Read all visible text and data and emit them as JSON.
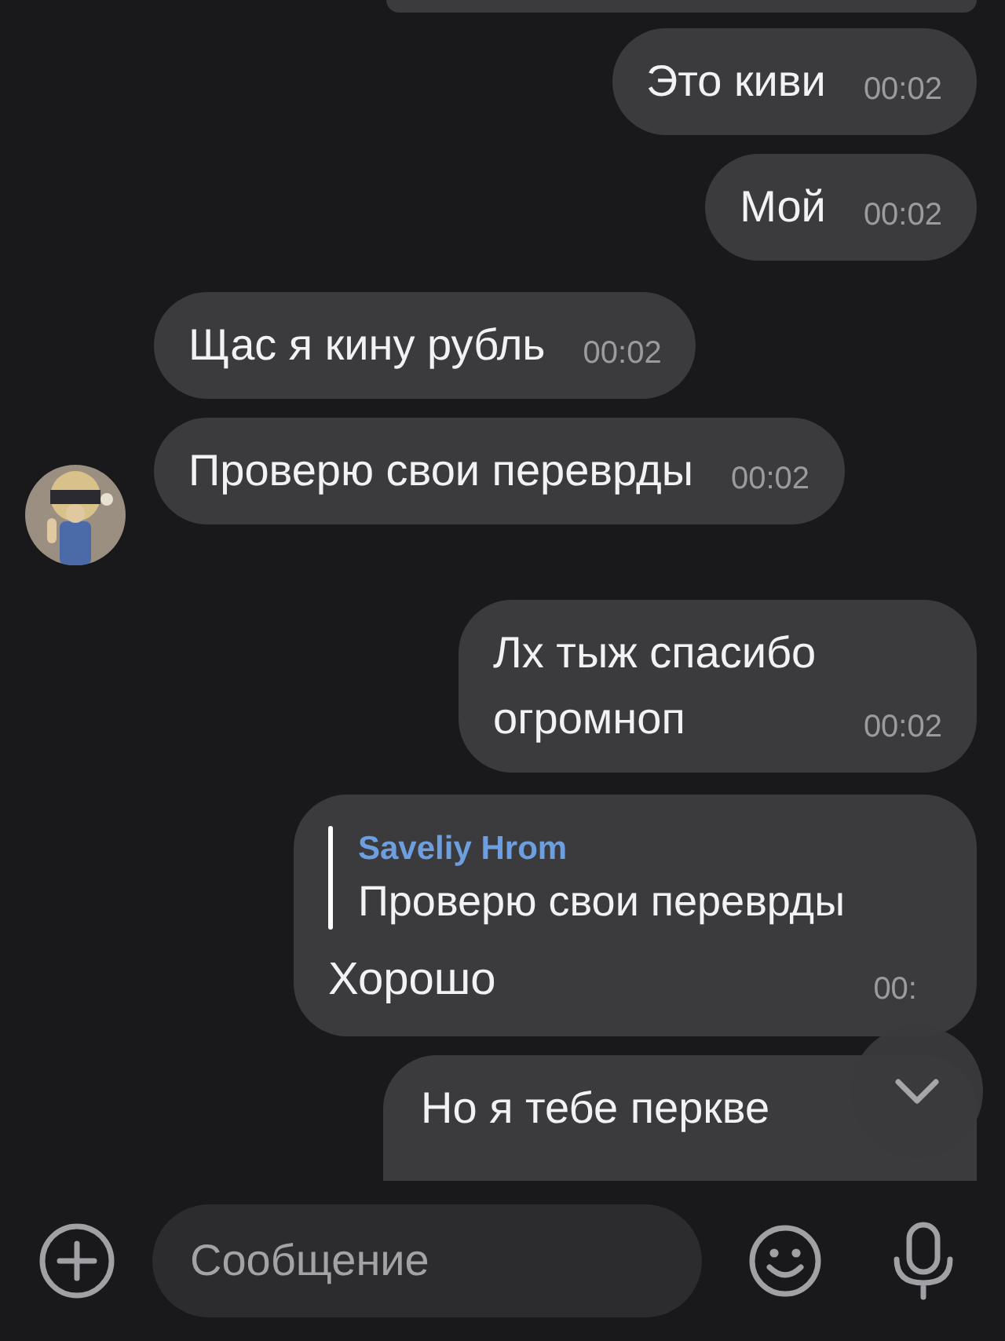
{
  "messages": [
    {
      "kind": "text",
      "outgoing": true,
      "text": "Это киви",
      "time": "00:02",
      "avatar": false
    },
    {
      "kind": "text",
      "outgoing": true,
      "text": "Мой",
      "time": "00:02",
      "avatar": false
    },
    {
      "kind": "text",
      "outgoing": false,
      "text": "Щас я кину рубль",
      "time": "00:02",
      "avatar": false
    },
    {
      "kind": "text",
      "outgoing": false,
      "text": "Проверю свои переврды",
      "time": "00:02",
      "avatar": true
    },
    {
      "kind": "text",
      "outgoing": true,
      "text": "Лх тыж спасибо огромноп",
      "time": "00:02",
      "avatar": false
    },
    {
      "kind": "reply",
      "outgoing": true,
      "quote_author": "Saveliy Hrom",
      "quote_text": "Проверю свои переврды",
      "text": "Хорошо",
      "time": "00:",
      "avatar": false
    },
    {
      "kind": "text",
      "outgoing": true,
      "text": "Но я тебе перкве",
      "avatar": false
    }
  ],
  "composer": {
    "placeholder": "Сообщение"
  }
}
